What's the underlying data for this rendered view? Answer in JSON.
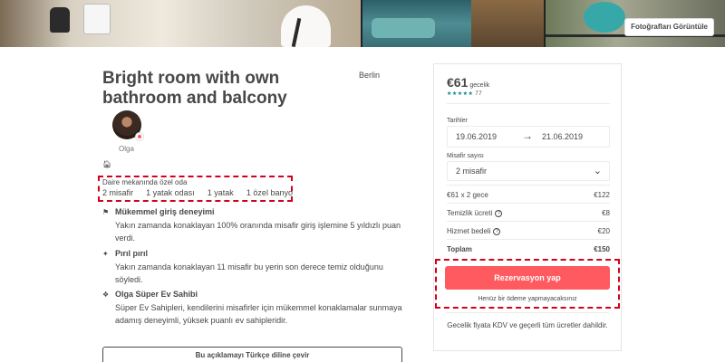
{
  "photos": {
    "view_button_label": "Fotoğrafları Görüntüle"
  },
  "listing": {
    "title": "Bright room with own bathroom and balcony",
    "city": "Berlin",
    "host_name": "Olga",
    "room_type": "Daire mekanında özel oda",
    "details": [
      "2 misafir",
      "1 yatak odası",
      "1 yatak",
      "1 özel banyo"
    ],
    "highlights": [
      {
        "icon": "medal-icon",
        "title": "Mükemmel giriş deneyimi",
        "description": "Yakın zamanda konaklayan 100% oranında misafir giriş işlemine 5 yıldızlı puan verdi."
      },
      {
        "icon": "sparkle-icon",
        "title": "Pırıl pırıl",
        "description": "Yakın zamanda konaklayan 11 misafir bu yerin son derece temiz olduğunu söyledi."
      },
      {
        "icon": "superhost-icon",
        "title": "Olga Süper Ev Sahibi",
        "description": "Süper Ev Sahipleri, kendilerini misafirler için mükemmel konaklamalar sunmaya adamış deneyimli, yüksek puanlı ev sahipleridir."
      }
    ],
    "translate_button": "Bu açıklamayı Türkçe diline çevir"
  },
  "booking": {
    "price": "€61",
    "price_unit": "gecelik",
    "stars": "★★★★★",
    "review_count": "77",
    "dates_label": "Tarihler",
    "check_in": "19.06.2019",
    "check_out": "21.06.2019",
    "guests_label": "Misafir sayısı",
    "guests_value": "2 misafir",
    "rows": [
      {
        "label": "€61 x 2 gece",
        "amount": "€122",
        "info": false
      },
      {
        "label": "Temizlik ücreti",
        "amount": "€8",
        "info": true
      },
      {
        "label": "Hizmet bedeli",
        "amount": "€20",
        "info": true
      },
      {
        "label": "Toplam",
        "amount": "€150",
        "info": false
      }
    ],
    "reserve_button": "Rezervasyon yap",
    "no_charge_note": "Henüz bir ödeme yapmayacaksınız",
    "vat_note": "Gecelik fiyata KDV ve geçerli tüm ücretler dahildir."
  },
  "colors": {
    "accent": "#ff5a5f",
    "teal": "#008489",
    "annotation": "#d0021b",
    "text": "#484848"
  }
}
